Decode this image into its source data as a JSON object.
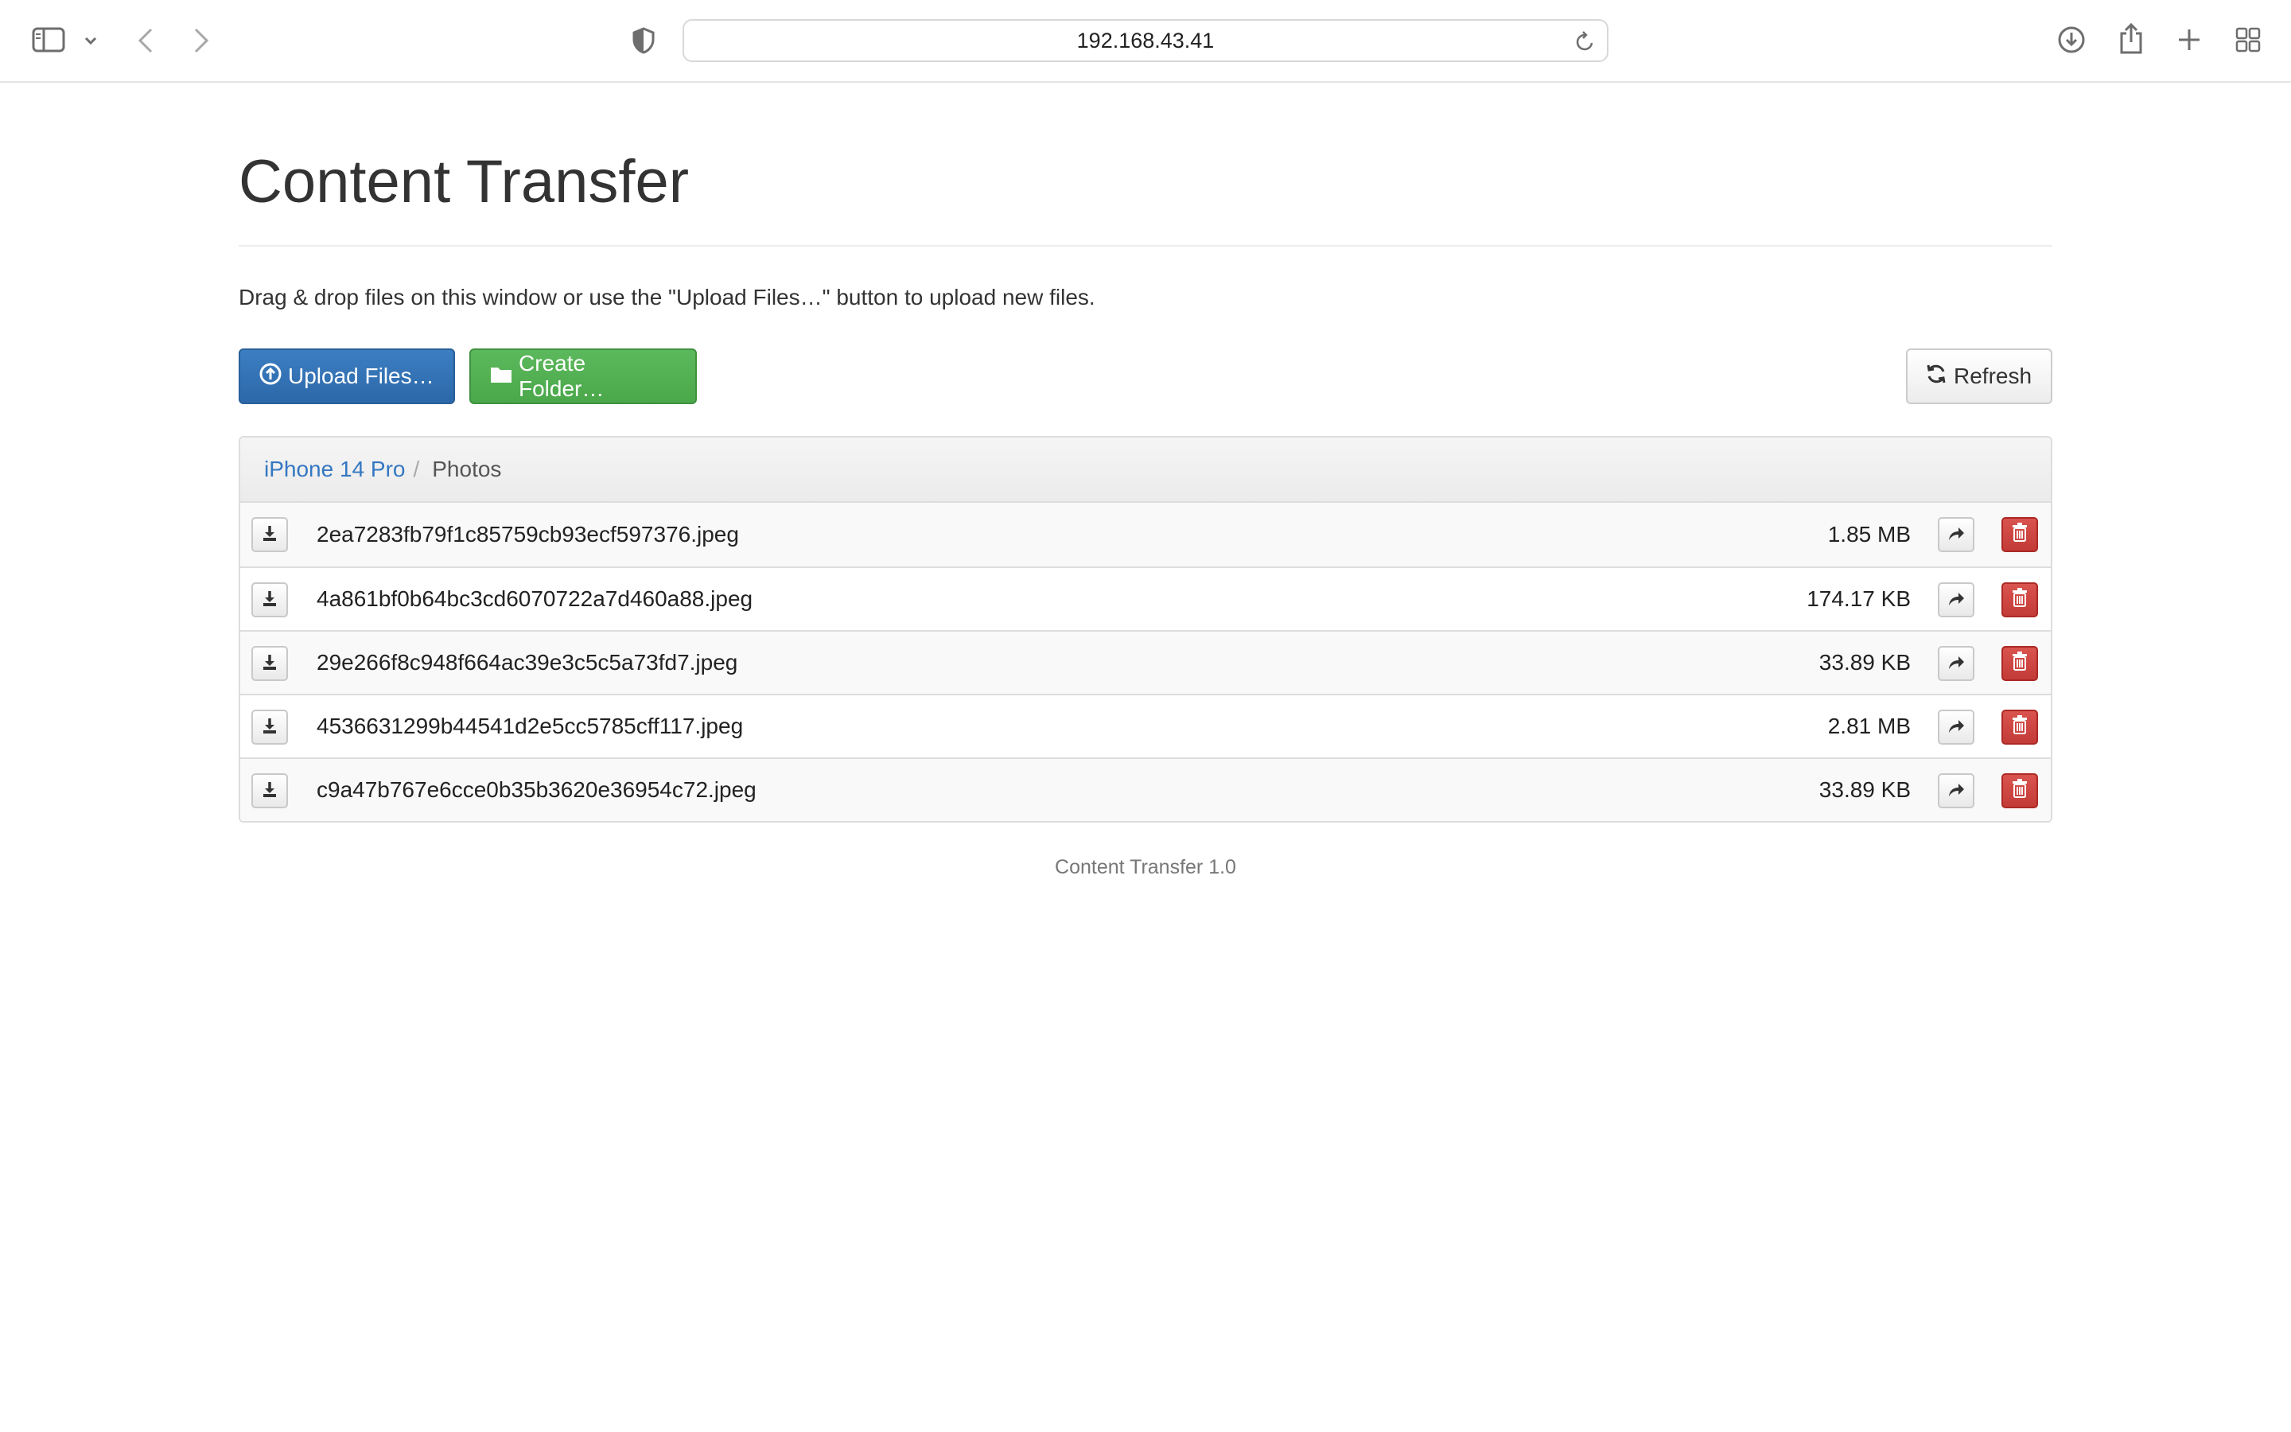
{
  "browser": {
    "address": "192.168.43.41"
  },
  "page": {
    "title": "Content Transfer",
    "intro": "Drag & drop files on this window or use the \"Upload Files…\" button to upload new files.",
    "upload_label": "Upload Files…",
    "create_folder_label": "Create Folder…",
    "refresh_label": "Refresh"
  },
  "breadcrumb": {
    "root": "iPhone 14 Pro",
    "separator": "/",
    "current": "Photos"
  },
  "files": [
    {
      "name": "2ea7283fb79f1c85759cb93ecf597376.jpeg",
      "size": "1.85 MB"
    },
    {
      "name": "4a861bf0b64bc3cd6070722a7d460a88.jpeg",
      "size": "174.17 KB"
    },
    {
      "name": "29e266f8c948f664ac39e3c5c5a73fd7.jpeg",
      "size": "33.89 KB"
    },
    {
      "name": "4536631299b44541d2e5cc5785cff117.jpeg",
      "size": "2.81 MB"
    },
    {
      "name": "c9a47b767e6cce0b35b3620e36954c72.jpeg",
      "size": "33.89 KB"
    }
  ],
  "footer": {
    "version": "Content Transfer 1.0"
  },
  "colors": {
    "primary": "#337ab7",
    "success": "#5cb85c",
    "danger": "#d9534f",
    "link": "#3477c1"
  }
}
